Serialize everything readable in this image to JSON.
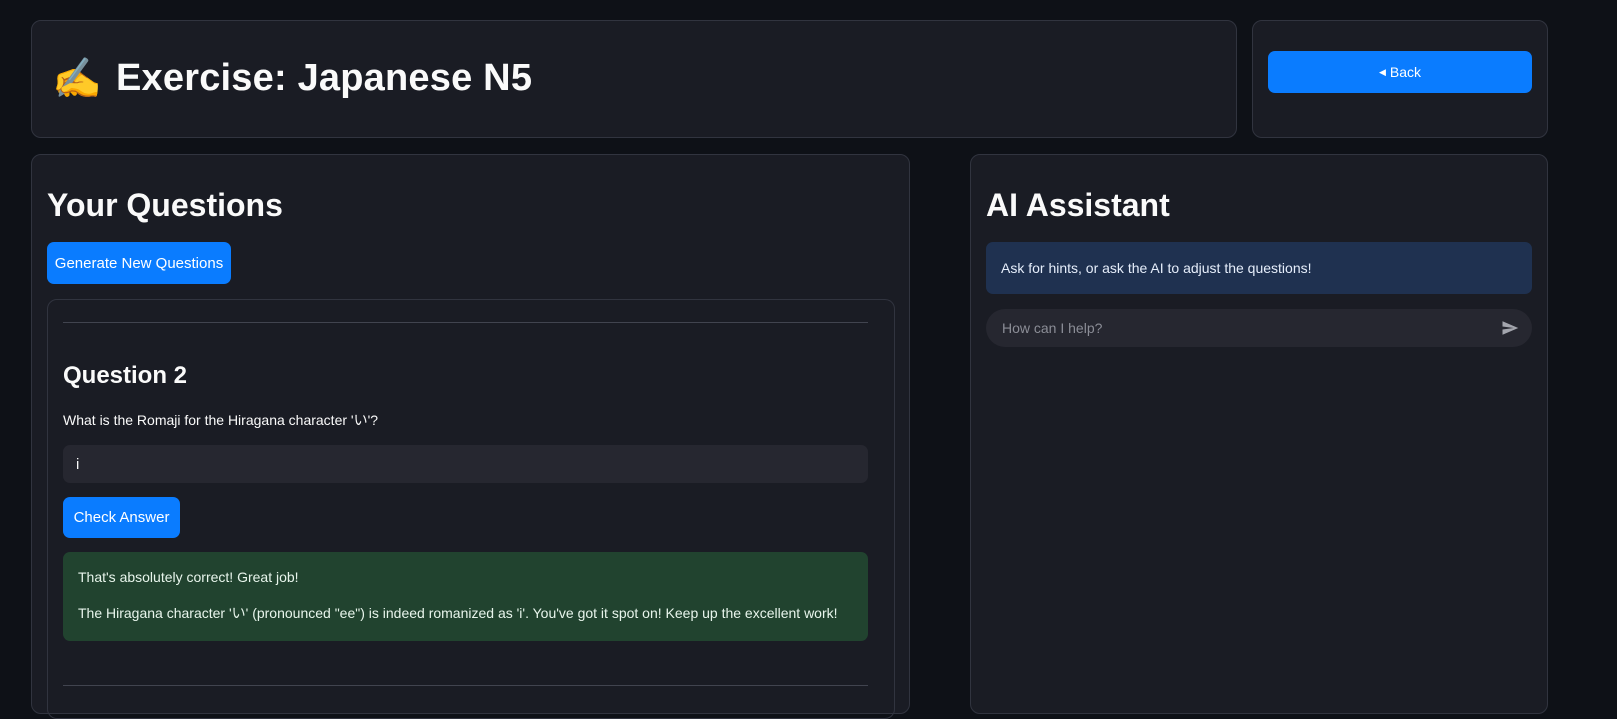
{
  "header": {
    "emoji": "✍️",
    "title": "Exercise: Japanese N5",
    "back_label": "Back"
  },
  "questions": {
    "title": "Your Questions",
    "generate_label": "Generate New Questions",
    "current": {
      "heading": "Question 2",
      "text": "What is the Romaji for the Hiragana character 'い'?",
      "answer_value": "i",
      "check_label": "Check Answer",
      "feedback_line1": "That's absolutely correct! Great job!",
      "feedback_line2": "The Hiragana character 'い' (pronounced \"ee\") is indeed romanized as 'i'. You've got it spot on! Keep up the excellent work!"
    }
  },
  "assistant": {
    "title": "AI Assistant",
    "info": "Ask for hints, or ask the AI to adjust the questions!",
    "placeholder": "How can I help?",
    "send_icon": "send-icon"
  },
  "colors": {
    "background": "#0e1117",
    "card": "#1a1c24",
    "accent": "#0a7cff",
    "success_bg": "#21432f",
    "info_bg": "#1f3150"
  }
}
